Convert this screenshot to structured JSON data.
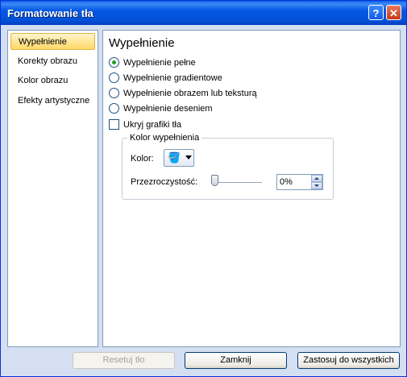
{
  "window": {
    "title": "Formatowanie tła",
    "help_label": "?",
    "close_label": "✕"
  },
  "nav": {
    "items": [
      {
        "label": "Wypełnienie",
        "selected": true
      },
      {
        "label": "Korekty obrazu",
        "selected": false
      },
      {
        "label": "Kolor obrazu",
        "selected": false
      },
      {
        "label": "Efekty artystyczne",
        "selected": false
      }
    ]
  },
  "main": {
    "title": "Wypełnienie",
    "options": [
      {
        "label": "Wypełnienie pełne",
        "checked": true
      },
      {
        "label": "Wypełnienie gradientowe",
        "checked": false
      },
      {
        "label": "Wypełnienie obrazem lub teksturą",
        "checked": false
      },
      {
        "label": "Wypełnienie deseniem",
        "checked": false
      }
    ],
    "hide_graphics": {
      "label": "Ukryj grafiki tła",
      "checked": false
    },
    "fill_color": {
      "group_title": "Kolor wypełnienia",
      "color_label": "Kolor:",
      "color_icon": "paint-bucket-icon",
      "transparency_label": "Przezroczystość:",
      "transparency_value": "0%",
      "transparency_percent": 0
    }
  },
  "footer": {
    "reset_label": "Resetuj tło",
    "close_label": "Zamknij",
    "apply_all_label": "Zastosuj do wszystkich"
  },
  "colors": {
    "title_bar": "#0458e3",
    "selected_nav": "#ffd966",
    "dialog_bg": "#d4dff2"
  }
}
